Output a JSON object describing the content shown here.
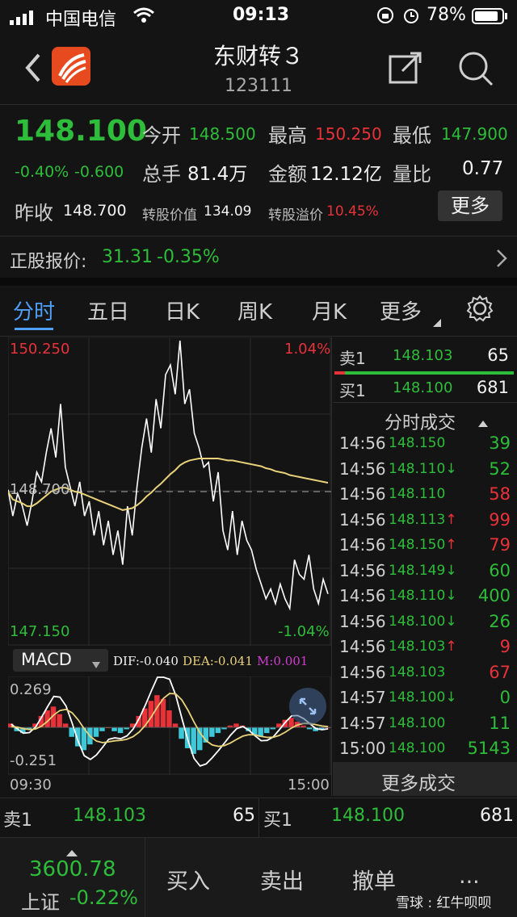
{
  "status": {
    "carrier": "中国电信",
    "time": "09:13",
    "battery": "78%"
  },
  "nav": {
    "title": "东财转３",
    "code": "123111"
  },
  "quote": {
    "price": "148.100",
    "pct": "-0.40%",
    "chg": "-0.600",
    "open_label": "今开",
    "open": "148.500",
    "high_label": "最高",
    "high": "150.250",
    "low_label": "最低",
    "low": "147.900",
    "vol_label": "总手",
    "vol": "81.4万",
    "amt_label": "金额",
    "amt": "12.12亿",
    "ratio_label": "量比",
    "ratio": "0.77",
    "prev_label": "昨收",
    "prev": "148.700",
    "conv_val_label": "转股价值",
    "conv_val": "134.09",
    "premium_label": "转股溢价",
    "premium": "10.45%",
    "more_label": "更多"
  },
  "stock": {
    "label": "正股报价:",
    "price": "31.31",
    "pct": "-0.35%"
  },
  "tabs": [
    "分时",
    "五日",
    "日K",
    "周K",
    "月K",
    "更多"
  ],
  "chart_data": [
    {
      "type": "line",
      "ylim": [
        147.15,
        150.25
      ],
      "ref_label": "148.700",
      "top_label": "150.250",
      "bottom_label": "147.150",
      "top_pct": "1.04%",
      "bottom_pct": "-1.04%",
      "series": [
        {
          "values": [
            148.72,
            148.45,
            148.68,
            148.55,
            148.35,
            148.6,
            148.9,
            148.8,
            149.1,
            149.35,
            149.05,
            149.6,
            148.95,
            148.75,
            148.55,
            148.8,
            148.45,
            148.6,
            148.25,
            148.5,
            148.15,
            148.4,
            148.05,
            148.3,
            147.95,
            148.55,
            148.25,
            148.75,
            149.15,
            149.45,
            149.1,
            149.65,
            149.35,
            149.9,
            150.0,
            149.7,
            150.25,
            149.6,
            149.75,
            149.3,
            149.15,
            148.95,
            149.0,
            148.6,
            148.9,
            148.3,
            148.1,
            148.5,
            148.05,
            148.4,
            148.2,
            148.1,
            147.9,
            147.75,
            147.6,
            147.7,
            147.55,
            147.75,
            147.6,
            147.5,
            148.0,
            147.85,
            147.8,
            148.05,
            147.7,
            147.55,
            147.8,
            147.65
          ]
        },
        {
          "values": [
            148.7,
            148.62,
            148.6,
            148.58,
            148.55,
            148.55,
            148.58,
            148.62,
            148.66,
            148.7,
            148.72,
            148.74,
            148.74,
            148.72,
            148.7,
            148.69,
            148.67,
            148.65,
            148.63,
            148.61,
            148.59,
            148.57,
            148.55,
            148.53,
            148.51,
            148.52,
            148.53,
            148.56,
            148.6,
            148.65,
            148.69,
            148.74,
            148.78,
            148.83,
            148.88,
            148.92,
            148.97,
            149.0,
            149.02,
            149.03,
            149.04,
            149.04,
            149.04,
            149.04,
            149.04,
            149.03,
            149.02,
            149.02,
            149.01,
            149.0,
            148.99,
            148.98,
            148.97,
            148.96,
            148.94,
            148.93,
            148.91,
            148.9,
            148.89,
            148.87,
            148.86,
            148.85,
            148.84,
            148.83,
            148.82,
            148.81,
            148.8,
            148.79
          ]
        }
      ]
    },
    {
      "type": "bar",
      "ylim": [
        -0.251,
        0.269
      ],
      "top_label": "0.269",
      "bottom_label": "-0.251",
      "x_start": "09:30",
      "x_end": "15:00",
      "indicator": "MACD",
      "dif": "DIF:-0.040",
      "dea": "DEA:-0.041",
      "m": "M:0.001",
      "values": [
        0.02,
        -0.02,
        -0.03,
        -0.01,
        0.02,
        0.06,
        0.09,
        0.11,
        0.07,
        0.02,
        -0.05,
        -0.1,
        -0.12,
        -0.09,
        -0.05,
        -0.02,
        0.0,
        -0.02,
        -0.03,
        -0.01,
        0.02,
        0.06,
        0.1,
        0.14,
        0.17,
        0.15,
        0.09,
        0.02,
        -0.06,
        -0.11,
        -0.14,
        -0.12,
        -0.08,
        -0.05,
        -0.03,
        -0.01,
        0.01,
        0.02,
        0.01,
        -0.02,
        -0.04,
        -0.05,
        -0.03,
        -0.01,
        0.02,
        0.04,
        0.05,
        0.03,
        0.01,
        -0.01,
        -0.02,
        -0.01,
        0.0
      ]
    }
  ],
  "orderbook": {
    "sell_label": "卖1",
    "sell_price": "148.103",
    "sell_vol": "65",
    "buy_label": "买1",
    "buy_price": "148.100",
    "buy_vol": "681"
  },
  "ticks_title": "分时成交",
  "ticks": [
    {
      "t": "14:56",
      "p": "148.150",
      "v": "39",
      "arrow": "",
      "c": "green"
    },
    {
      "t": "14:56",
      "p": "148.110↓",
      "v": "52",
      "arrow": "down",
      "c": "green"
    },
    {
      "t": "14:56",
      "p": "148.110",
      "v": "58",
      "arrow": "",
      "c": "red"
    },
    {
      "t": "14:56",
      "p": "148.113↑",
      "v": "99",
      "arrow": "up",
      "c": "red"
    },
    {
      "t": "14:56",
      "p": "148.150↑",
      "v": "79",
      "arrow": "up",
      "c": "red"
    },
    {
      "t": "14:56",
      "p": "148.149↓",
      "v": "60",
      "arrow": "down",
      "c": "green"
    },
    {
      "t": "14:56",
      "p": "148.110↓",
      "v": "400",
      "arrow": "down",
      "c": "green"
    },
    {
      "t": "14:56",
      "p": "148.100↓",
      "v": "26",
      "arrow": "down",
      "c": "green"
    },
    {
      "t": "14:56",
      "p": "148.103↑",
      "v": "9",
      "arrow": "up",
      "c": "red"
    },
    {
      "t": "14:56",
      "p": "148.103",
      "v": "67",
      "arrow": "",
      "c": "red"
    },
    {
      "t": "14:57",
      "p": "148.100↓",
      "v": "0",
      "arrow": "down",
      "c": "green"
    },
    {
      "t": "14:57",
      "p": "148.100",
      "v": "11",
      "arrow": "",
      "c": "green"
    },
    {
      "t": "15:00",
      "p": "148.100",
      "v": "5143",
      "arrow": "",
      "c": "green"
    }
  ],
  "more_ticks": "更多成交",
  "bottom": {
    "sell_label": "卖1",
    "sell_price": "148.103",
    "sell_vol": "65",
    "buy_label": "买1",
    "buy_price": "148.100",
    "buy_vol": "681",
    "index_value": "3600.78",
    "index_name": "上证",
    "index_pct": "-0.22%",
    "buy_btn": "买入",
    "sell_btn": "卖出",
    "cancel_btn": "撤单",
    "more_btn": "...",
    "watermark": "雪球 : 红牛呗呗"
  },
  "colors": {
    "up": "#e8323a",
    "down": "#2ebd3a",
    "price_line": "#ffffff",
    "avg_line": "#e8d27a",
    "bg": "#141414"
  }
}
